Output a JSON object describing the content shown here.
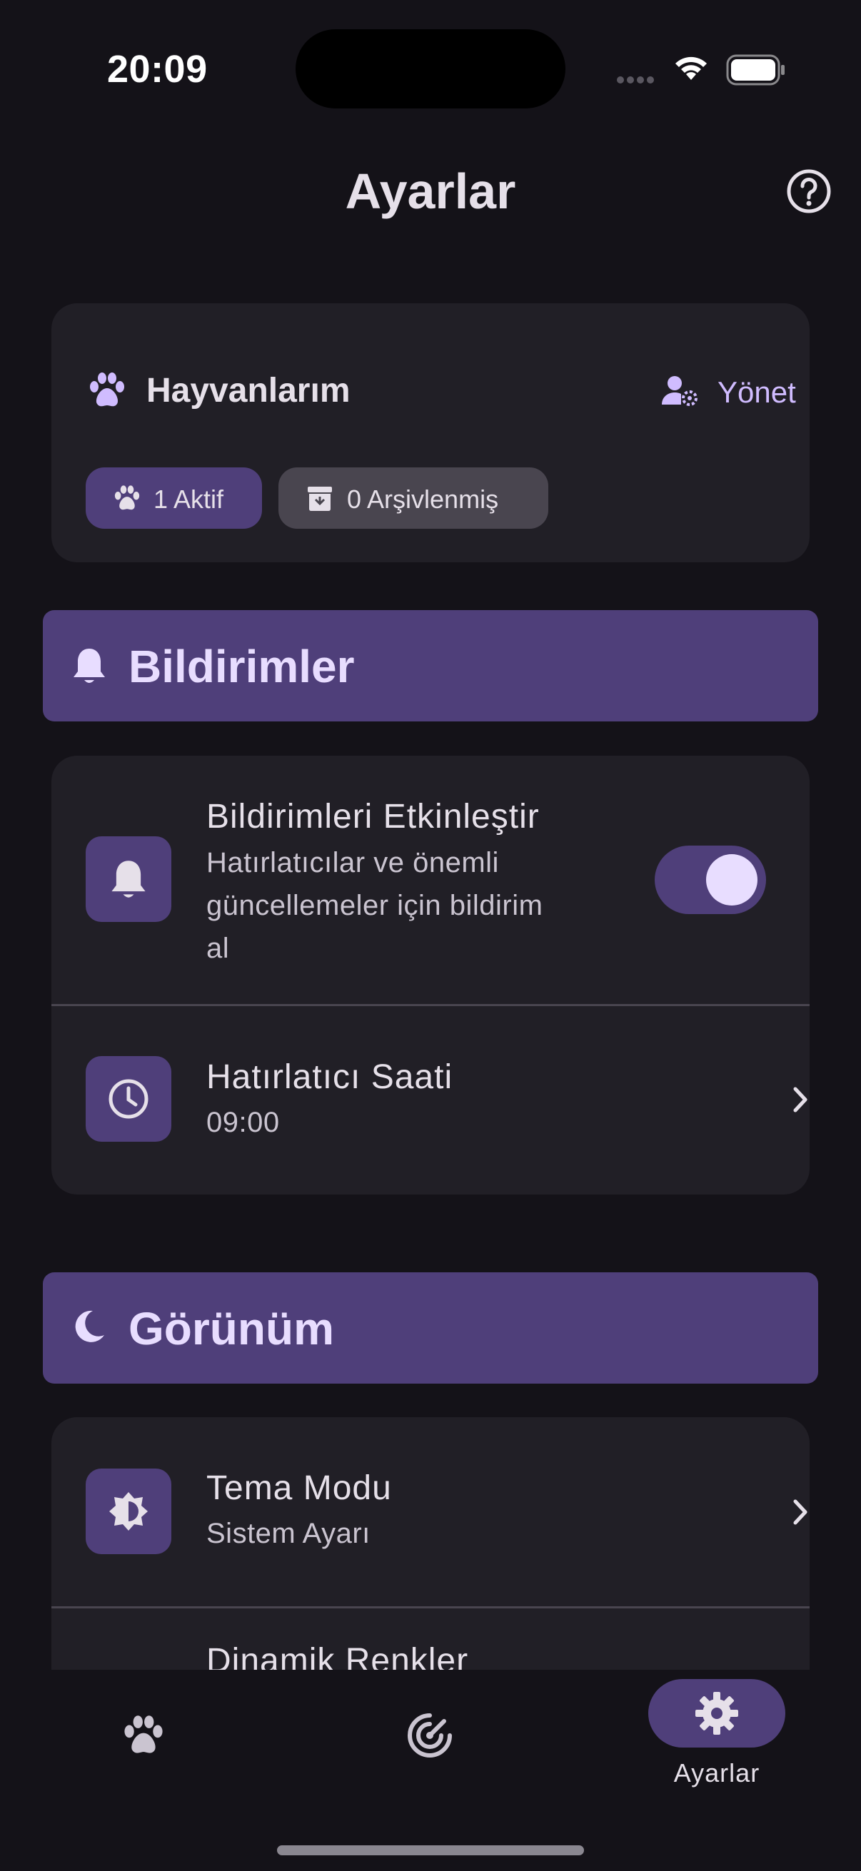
{
  "status_bar": {
    "time": "20:09",
    "icons": [
      "signal-icon",
      "wifi-icon",
      "battery-icon"
    ]
  },
  "app_bar": {
    "title": "Ayarlar",
    "help_icon": "help-circle-icon"
  },
  "pets_card": {
    "title": "Hayvanlarım",
    "manage_label": "Yönet",
    "chips": {
      "active": "1 Aktif",
      "archived": "0 Arşivlenmiş"
    }
  },
  "sections": {
    "notifications": {
      "header": "Bildirimler",
      "enable": {
        "title": "Bildirimleri Etkinleştir",
        "subtitle_lines": [
          "Hatırlatıcılar ve önemli",
          "güncellemeler için bildirim",
          "al"
        ],
        "enabled": true
      },
      "reminder_time": {
        "title": "Hatırlatıcı Saati",
        "value": "09:00"
      }
    },
    "appearance": {
      "header": "Görünüm",
      "theme_mode": {
        "title": "Tema Modu",
        "value": "Sistem Ayarı"
      },
      "dynamic_colors": {
        "title": "Dinamik Renkler"
      }
    }
  },
  "nav": {
    "items": [
      {
        "icon": "paw-icon",
        "label": ""
      },
      {
        "icon": "radar-icon",
        "label": ""
      },
      {
        "icon": "gear-icon",
        "label": "Ayarlar",
        "selected": true
      }
    ]
  },
  "colors": {
    "background": "#141218",
    "card": "#211F26",
    "accent_container": "#4F3F7A",
    "accent": "#D0BCFF"
  }
}
